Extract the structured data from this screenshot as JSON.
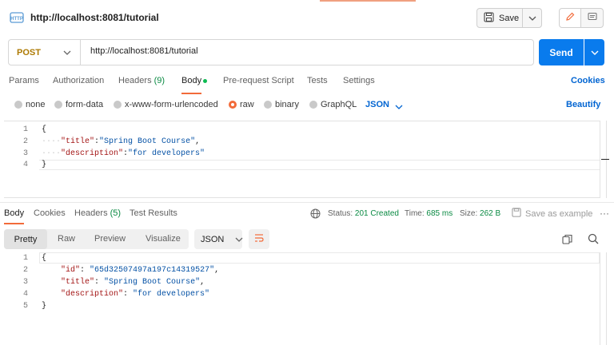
{
  "header": {
    "request_title": "http://localhost:8081/tutorial",
    "save_label": "Save"
  },
  "url_bar": {
    "method": "POST",
    "url": "http://localhost:8081/tutorial",
    "send_label": "Send"
  },
  "request_tabs": {
    "params": "Params",
    "authorization": "Authorization",
    "headers": "Headers",
    "headers_count": "(9)",
    "body": "Body",
    "pre_request": "Pre-request Script",
    "tests": "Tests",
    "settings": "Settings",
    "cookies": "Cookies"
  },
  "body_types": {
    "none": "none",
    "form_data": "form-data",
    "urlencoded": "x-www-form-urlencoded",
    "raw": "raw",
    "binary": "binary",
    "graphql": "GraphQL",
    "format": "JSON",
    "beautify": "Beautify",
    "selected": "raw"
  },
  "request_body": {
    "line_numbers": [
      "1",
      "2",
      "3",
      "4"
    ],
    "open_brace": "{",
    "close_brace": "}",
    "title_key": "\"title\"",
    "title_value": "\"Spring Boot Course\"",
    "description_key": "\"description\"",
    "description_value": "\"for developers\""
  },
  "response_tabs": {
    "body": "Body",
    "cookies": "Cookies",
    "headers": "Headers",
    "headers_count": "(5)",
    "test_results": "Test Results"
  },
  "response_status": {
    "status_label": "Status:",
    "status_value": "201 Created",
    "time_label": "Time:",
    "time_value": "685 ms",
    "size_label": "Size:",
    "size_value": "262 B",
    "save_as_example": "Save as example"
  },
  "response_format": {
    "pretty": "Pretty",
    "raw": "Raw",
    "preview": "Preview",
    "visualize": "Visualize",
    "format": "JSON"
  },
  "response_body": {
    "line_numbers": [
      "1",
      "2",
      "3",
      "4",
      "5"
    ],
    "open_brace": "{",
    "close_brace": "}",
    "id_key": "\"id\"",
    "id_value": "\"65d32507497a197c14319527\"",
    "title_key": "\"title\"",
    "title_value": "\"Spring Boot Course\"",
    "description_key": "\"description\"",
    "description_value": "\"for developers\""
  },
  "colors": {
    "accent_orange": "#f26b3a",
    "send_blue": "#097bed",
    "method_post": "#ad7a03",
    "status_green": "#0a8a43",
    "link_blue": "#0265d2"
  }
}
